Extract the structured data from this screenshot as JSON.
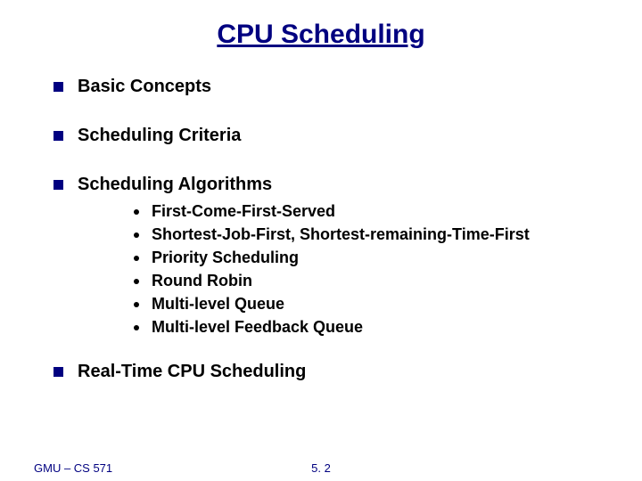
{
  "title": "CPU Scheduling",
  "items": [
    {
      "label": "Basic Concepts"
    },
    {
      "label": "Scheduling Criteria"
    },
    {
      "label": "Scheduling Algorithms"
    },
    {
      "label": "Real-Time CPU Scheduling"
    }
  ],
  "subitems": [
    {
      "label": "First-Come-First-Served"
    },
    {
      "label": "Shortest-Job-First, Shortest-remaining-Time-First"
    },
    {
      "label": "Priority Scheduling"
    },
    {
      "label": "Round Robin"
    },
    {
      "label": "Multi-level Queue"
    },
    {
      "label": "Multi-level Feedback Queue"
    }
  ],
  "footer": {
    "left": "GMU – CS 571",
    "center": "5. 2"
  }
}
